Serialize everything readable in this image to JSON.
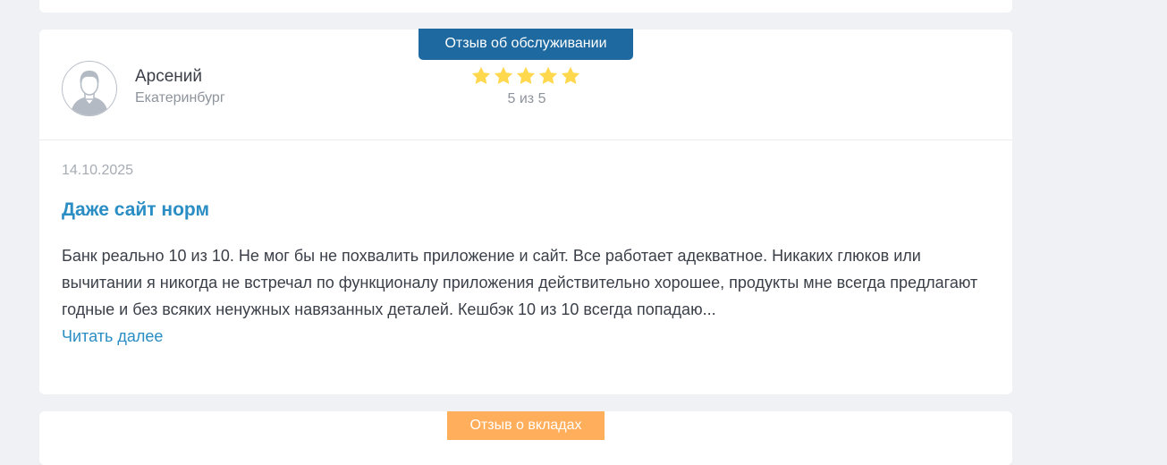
{
  "previous_review": {},
  "review": {
    "category_badge": "Отзыв об обслуживании",
    "author": {
      "name": "Арсений",
      "city": "Екатеринбург",
      "avatar_icon": "user-silhouette-icon"
    },
    "rating": {
      "value": 5,
      "max": 5,
      "label": "5 из 5",
      "star_color": "#ffd84d"
    },
    "date": "14.10.2025",
    "title": "Даже сайт норм",
    "body": "Банк реально 10 из 10. Не мог бы не похвалить приложение и сайт. Все работает адекватное. Никаких глюков или вычитании я никогда не встречал по функционалу приложения действительно хорошее, продукты мне всегда предлагают годные и без всяких ненужных навязанных деталей. Кешбэк 10 из 10 всегда попадаю...",
    "read_more": "Читать далее"
  },
  "next_review": {
    "category_badge": "Отзыв о вкладах"
  },
  "colors": {
    "page_bg": "#eff1f4",
    "card_bg": "#ffffff",
    "badge_service": "#1e6aa0",
    "badge_deposits": "#ffae5c",
    "link": "#2a8dc3",
    "star": "#ffd84d"
  }
}
